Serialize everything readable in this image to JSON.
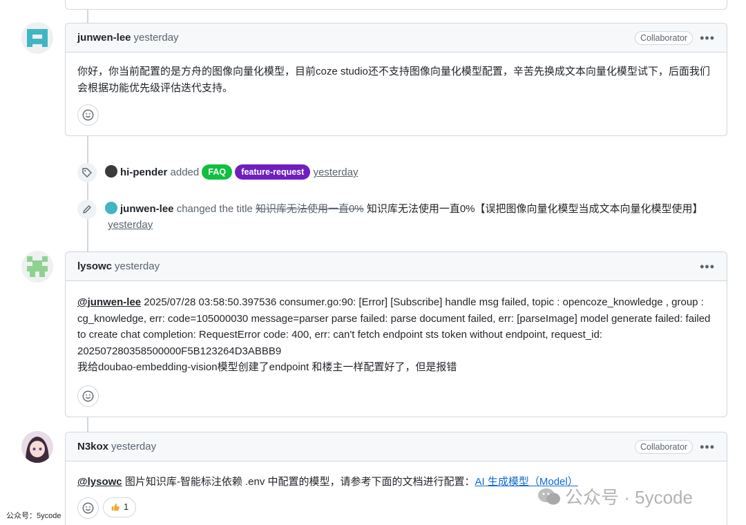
{
  "comments": [
    {
      "author": "junwen-lee",
      "time": "yesterday",
      "badge": "Collaborator",
      "body": "你好，你当前配置的是方舟的图像向量化模型，目前coze studio还不支持图像向量化模型配置，辛苦先换成文本向量化模型试下，后面我们会根据功能优先级评估迭代支持。"
    },
    {
      "author": "lysowc",
      "time": "yesterday",
      "mention": "@junwen-lee",
      "body": " 2025/07/28 03:58:50.397536 consumer.go:90: [Error] [Subscribe] handle msg failed, topic : opencoze_knowledge , group : cg_knowledge, err: code=105000030 message=parser parse failed: parse document failed, err: [parseImage] model generate failed: failed to create chat completion: RequestError code: 400, err: can't fetch endpoint sts token without endpoint, request_id: 202507280358500000F5B123264D3ABBB9",
      "body2": "我给doubao-embedding-vision模型创建了endpoint 和楼主一样配置好了，但是报错"
    },
    {
      "author": "N3kox",
      "time": "yesterday",
      "badge": "Collaborator",
      "mention": "@lysowc",
      "body": " 图片知识库-智能标注依赖 .env 中配置的模型，请参考下面的文档进行配置：",
      "link": "AI 生成模型（Model）",
      "reaction_count": "1"
    }
  ],
  "events": {
    "labels": {
      "actor": "hi-pender",
      "verb": "added",
      "label1": "FAQ",
      "label2": "feature-request",
      "time": "yesterday"
    },
    "rename": {
      "actor": "junwen-lee",
      "verb": "changed the title",
      "old_title": "知识库无法使用一直0%",
      "new_title": "知识库无法使用一直0%【误把图像向量化模型当成文本向量化模型使用】",
      "time": "yesterday"
    }
  },
  "watermark": "公众号 · 5ycode",
  "corner_note": "公众号：5ycode",
  "colors": {
    "faq": "#0fbf3e",
    "feature_request": "#6e1fbf",
    "link": "#0969da"
  }
}
